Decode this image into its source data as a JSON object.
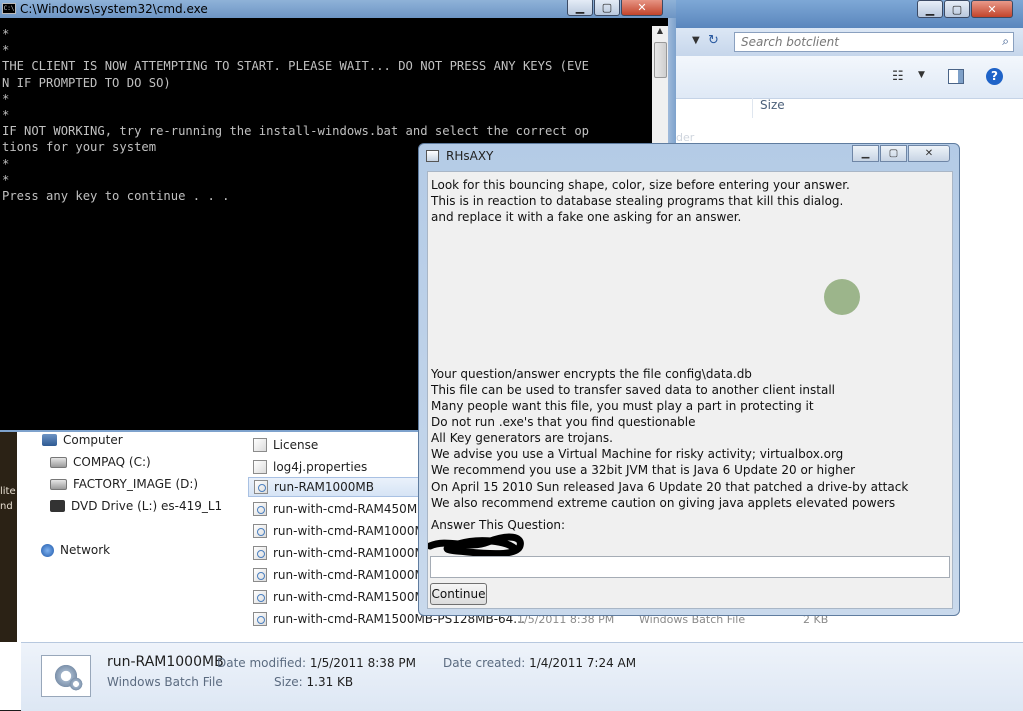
{
  "cmd": {
    "title": "C:\\Windows\\system32\\cmd.exe",
    "icon_text": "C:\\",
    "lines": [
      "*",
      "*",
      "THE CLIENT IS NOW ATTEMPTING TO START. PLEASE WAIT... DO NOT PRESS ANY KEYS (EVE",
      "N IF PROMPTED TO DO SO)",
      "*",
      "*",
      "IF NOT WORKING, try re-running the install-windows.bat and select the correct op",
      "tions for your system",
      "*",
      "*",
      "Press any key to continue . . ."
    ]
  },
  "explorer": {
    "search_placeholder": "Search botclient",
    "column_size": "Size",
    "folder_ghost": "der",
    "left_strip": [
      "lite",
      "nd"
    ],
    "nav": [
      {
        "label": "Computer",
        "icon": "computer-icon"
      },
      {
        "label": "COMPAQ (C:)",
        "icon": "drive-icon"
      },
      {
        "label": "FACTORY_IMAGE (D:)",
        "icon": "drive-icon"
      },
      {
        "label": "DVD Drive (L:) es-419_L1",
        "icon": "dvd-icon"
      },
      {
        "label": "Network",
        "icon": "network-icon"
      }
    ],
    "files": [
      {
        "name": "License",
        "type": "file"
      },
      {
        "name": "log4j.properties",
        "type": "file"
      },
      {
        "name": "run-RAM1000MB",
        "type": "bat"
      },
      {
        "name": "run-with-cmd-RAM450MB",
        "type": "bat"
      },
      {
        "name": "run-with-cmd-RAM1000MB",
        "type": "bat"
      },
      {
        "name": "run-with-cmd-RAM1000MB",
        "type": "bat"
      },
      {
        "name": "run-with-cmd-RAM1000MB",
        "type": "bat"
      },
      {
        "name": "run-with-cmd-RAM1500MB",
        "type": "bat"
      },
      {
        "name": "run-with-cmd-RAM1500MB-PS128MB-64...",
        "type": "bat"
      }
    ],
    "last_row_meta": {
      "date": "1/5/2011 8:38 PM",
      "type": "Windows Batch File",
      "size": "2 KB"
    },
    "details": {
      "name": "run-RAM1000MB",
      "type": "Windows Batch File",
      "modified_label": "Date modified:",
      "modified": "1/5/2011 8:38 PM",
      "created_label": "Date created:",
      "created": "1/4/2011 7:24 AM",
      "size_label": "Size:",
      "size": "1.31 KB"
    }
  },
  "dialog": {
    "title": "RHsAXY",
    "top_lines": [
      "Look for this bouncing shape, color, size before entering your answer.",
      "This is in reaction to database stealing programs that kill this dialog.",
      "and replace it with a fake one asking for an answer."
    ],
    "bottom_lines": [
      "Your question/answer encrypts the file config\\data.db",
      "This file can be used to transfer saved data to another client install",
      "Many people want this file, you must play a part in protecting it",
      "Do not run .exe's that you find questionable",
      "All Key generators are trojans.",
      "We advise you use a Virtual Machine for risky activity; virtualbox.org",
      "We recommend you use a 32bit JVM that is Java 6 Update 20 or higher",
      "On April 15 2010 Sun released Java 6 Update 20 that patched a drive-by attack",
      "We also recommend extreme caution on giving java applets elevated powers"
    ],
    "answer_label": "Answer This Question:",
    "answer_value": "",
    "continue_label": "Continue",
    "dot_color": "#9cb58b"
  }
}
